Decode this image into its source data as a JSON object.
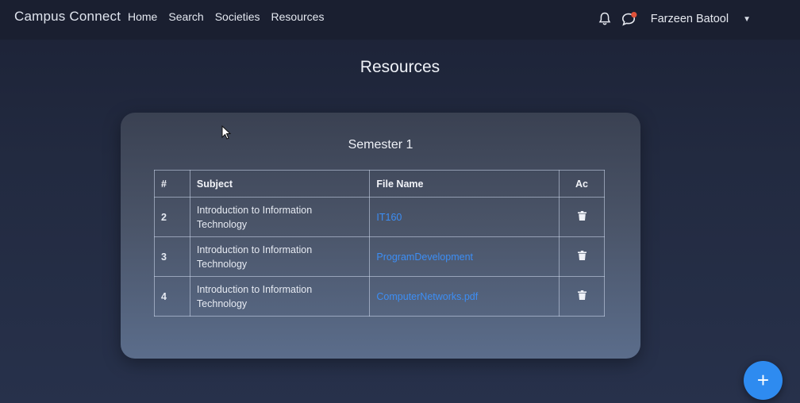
{
  "navbar": {
    "brand": "Campus Connect",
    "links": [
      "Home",
      "Search",
      "Societies",
      "Resources"
    ],
    "user_name": "Farzeen Batool"
  },
  "page": {
    "title": "Resources"
  },
  "semester": {
    "title": "Semester 1",
    "columns": [
      "#",
      "Subject",
      "File Name",
      "Ac"
    ],
    "rows": [
      {
        "num": "2",
        "subject": "Introduction to Information Technology",
        "file": "IT160"
      },
      {
        "num": "3",
        "subject": "Introduction to Information Technology",
        "file": "ProgramDevelopment"
      },
      {
        "num": "4",
        "subject": "Introduction to Information Technology",
        "file": "ComputerNetworks.pdf"
      }
    ]
  },
  "icons": {
    "notifications": "bell-icon",
    "messages": "chat-icon",
    "delete": "trash-icon",
    "add": "plus-icon"
  },
  "colors": {
    "accent": "#2e8bf0",
    "link": "#3c8ef5",
    "notification_dot": "#e0523a"
  }
}
